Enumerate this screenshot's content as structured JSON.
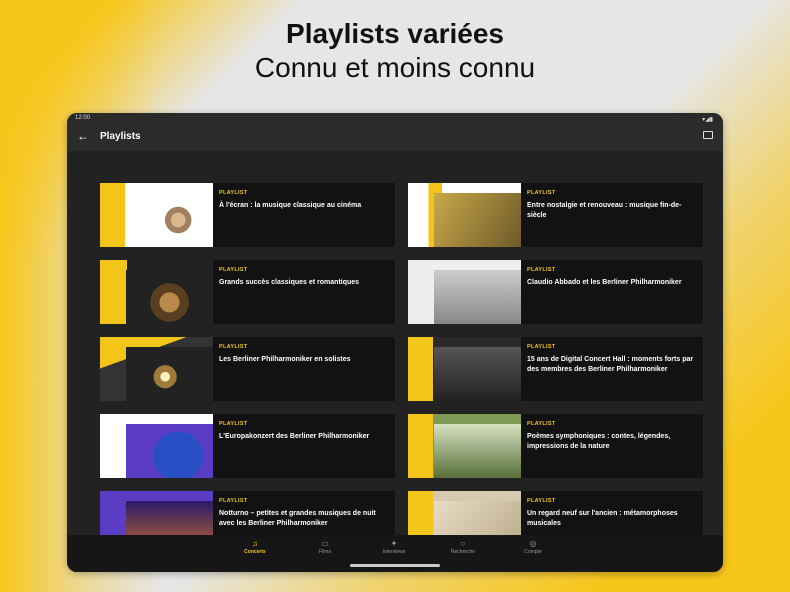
{
  "headline": {
    "title": "Playlists variées",
    "subtitle": "Connu et moins connu"
  },
  "status": {
    "time": "12:00",
    "icons": "▾◢▮"
  },
  "appbar": {
    "title": "Playlists"
  },
  "icons": {
    "back": "back-arrow-icon",
    "cast": "cast-icon"
  },
  "cards": [
    {
      "type": "PLAYLIST",
      "title": "À l'écran : la musique classique au cinéma"
    },
    {
      "type": "PLAYLIST",
      "title": "Entre nostalgie et renouveau : musique fin-de-siècle"
    },
    {
      "type": "PLAYLIST",
      "title": "Grands succès classiques et romantiques"
    },
    {
      "type": "PLAYLIST",
      "title": "Claudio Abbado et les Berliner Philharmoniker"
    },
    {
      "type": "PLAYLIST",
      "title": "Les Berliner Philharmoniker en solistes"
    },
    {
      "type": "PLAYLIST",
      "title": "15 ans de Digital Concert Hall : moments forts par des membres des Berliner Philharmoniker"
    },
    {
      "type": "PLAYLIST",
      "title": "L'Europakonzert des Berliner Philharmoniker"
    },
    {
      "type": "PLAYLIST",
      "title": "Poèmes symphoniques : contes, légendes, impressions de la nature"
    },
    {
      "type": "PLAYLIST",
      "title": "Notturno – petites et grandes musiques de nuit avec les Berliner Philharmoniker"
    },
    {
      "type": "PLAYLIST",
      "title": "Un regard neuf sur l'ancien : métamorphoses musicales"
    }
  ],
  "nav": [
    {
      "label": "Concerts",
      "icon": "concerts-icon",
      "glyph": "♫",
      "active": true
    },
    {
      "label": "Films",
      "icon": "films-icon",
      "glyph": "▭",
      "active": false
    },
    {
      "label": "Interviews",
      "icon": "interviews-icon",
      "glyph": "✦",
      "active": false
    },
    {
      "label": "Recherche",
      "icon": "search-icon",
      "glyph": "○",
      "active": false
    },
    {
      "label": "Compte",
      "icon": "account-icon",
      "glyph": "◎",
      "active": false
    }
  ],
  "colors": {
    "accent": "#f2c518",
    "background": "#222222",
    "card": "#121212"
  }
}
